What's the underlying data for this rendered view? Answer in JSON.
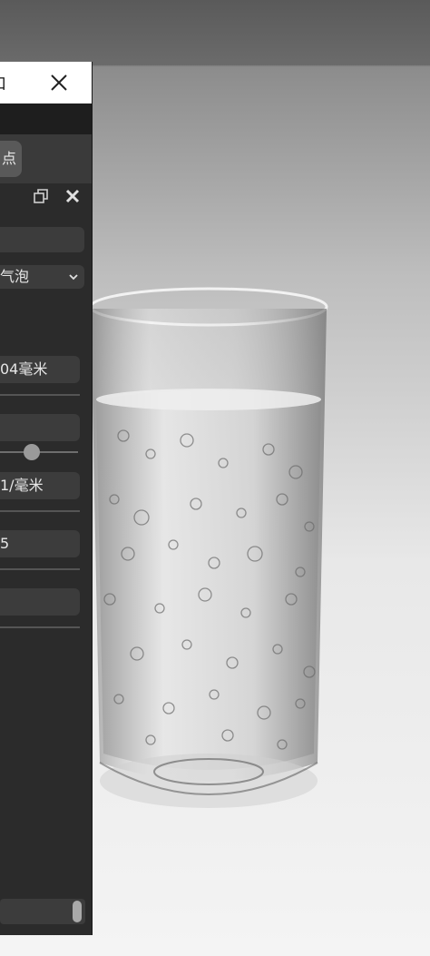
{
  "window": {
    "title_fragment": "口"
  },
  "tab": {
    "label": "点"
  },
  "params": {
    "dropdown_value": "气泡",
    "row1_value": "04毫米",
    "row2_value": "1/毫米",
    "row3_value": "5"
  },
  "icons": {
    "close": "close-icon",
    "float": "float-window-icon",
    "chevron": "chevron-down-icon"
  }
}
